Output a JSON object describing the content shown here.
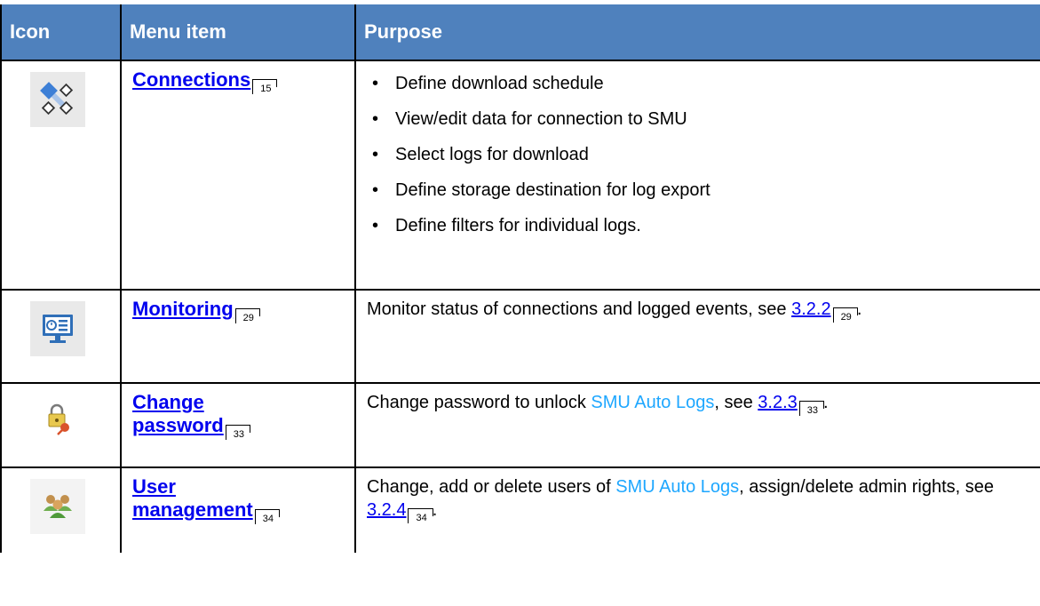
{
  "table": {
    "headers": {
      "icon": "Icon",
      "menu_item": "Menu item",
      "purpose": "Purpose"
    },
    "rows": [
      {
        "icon": "connections-icon",
        "menu_item": "Connections",
        "page_ref": "15",
        "purpose_list": [
          "Define download schedule",
          "View/edit data for connection to SMU",
          "Select logs for download",
          "Define storage destination for log export",
          "Define filters for individual logs."
        ]
      },
      {
        "icon": "monitoring-icon",
        "menu_item": "Monitoring",
        "page_ref": "29",
        "purpose_text": "Monitor status of connections and logged events, see ",
        "section_link": "3.2.2",
        "section_page_ref": "29",
        "purpose_tail": "."
      },
      {
        "icon": "change-password-icon",
        "menu_item_line1": "Change",
        "menu_item_line2": "password",
        "page_ref": "33",
        "purpose_text": "Change password to unlock ",
        "app_name": "SMU Auto Logs",
        "purpose_mid": ", see ",
        "section_link": "3.2.3",
        "section_page_ref": "33",
        "purpose_tail": "."
      },
      {
        "icon": "user-management-icon",
        "menu_item_line1": "User",
        "menu_item_line2": "management",
        "page_ref": "34",
        "purpose_text": "Change, add or delete users of ",
        "app_name": "SMU Auto Logs",
        "purpose_mid": ", assign/delete admin rights, see ",
        "section_link": "3.2.4",
        "section_page_ref": "34",
        "purpose_tail": "."
      }
    ]
  },
  "colors": {
    "header_bg": "#4f81bd",
    "header_text": "#ffffff",
    "link": "#0000ee",
    "app_name": "#1ea7ff"
  }
}
